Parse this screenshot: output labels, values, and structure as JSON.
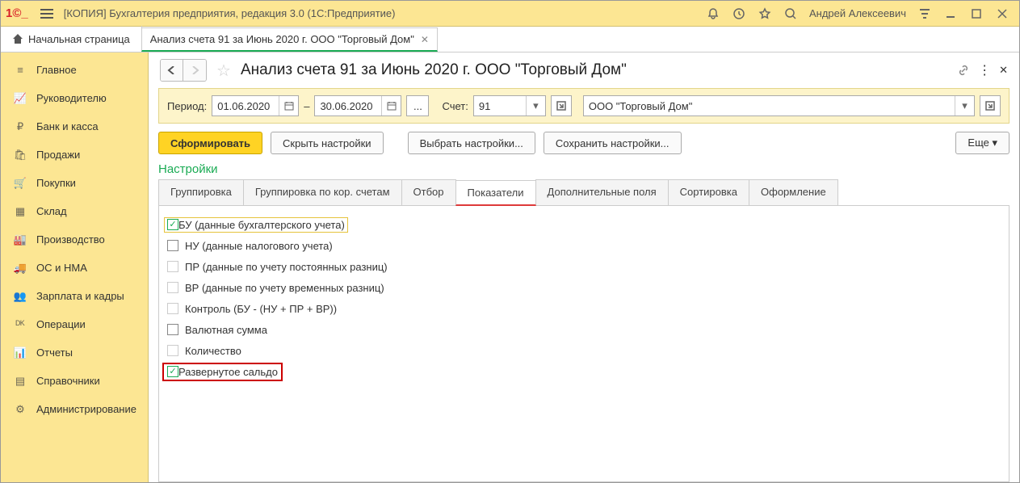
{
  "titlebar": {
    "title": "[КОПИЯ] Бухгалтерия предприятия, редакция 3.0  (1С:Предприятие)",
    "user": "Андрей Алексеевич"
  },
  "tabs": {
    "home": "Начальная страница",
    "doc": "Анализ счета 91 за Июнь 2020 г. ООО \"Торговый Дом\""
  },
  "sidebar": [
    "Главное",
    "Руководителю",
    "Банк и касса",
    "Продажи",
    "Покупки",
    "Склад",
    "Производство",
    "ОС и НМА",
    "Зарплата и кадры",
    "Операции",
    "Отчеты",
    "Справочники",
    "Администрирование"
  ],
  "page": {
    "title": "Анализ счета 91 за Июнь 2020 г. ООО \"Торговый Дом\""
  },
  "params": {
    "period_lbl": "Период:",
    "date_from": "01.06.2020",
    "dash": "–",
    "date_to": "30.06.2020",
    "account_lbl": "Счет:",
    "account": "91",
    "org": "ООО \"Торговый Дом\""
  },
  "buttons": {
    "form": "Сформировать",
    "hide": "Скрыть настройки",
    "choose": "Выбрать настройки...",
    "save": "Сохранить настройки...",
    "more": "Еще"
  },
  "settings_title": "Настройки",
  "tabs2": [
    "Группировка",
    "Группировка по кор. счетам",
    "Отбор",
    "Показатели",
    "Дополнительные поля",
    "Сортировка",
    "Оформление"
  ],
  "tabs2_active": 3,
  "checks": [
    {
      "label": "БУ (данные бухгалтерского учета)",
      "checked": true,
      "disabled": false,
      "first": true
    },
    {
      "label": "НУ (данные налогового учета)",
      "checked": false,
      "disabled": false
    },
    {
      "label": "ПР (данные по учету постоянных разниц)",
      "checked": false,
      "disabled": true
    },
    {
      "label": "ВР (данные по учету временных разниц)",
      "checked": false,
      "disabled": true
    },
    {
      "label": "Контроль (БУ - (НУ + ПР + ВР))",
      "checked": false,
      "disabled": true
    },
    {
      "label": "Валютная сумма",
      "checked": false,
      "disabled": false
    },
    {
      "label": "Количество",
      "checked": false,
      "disabled": true
    },
    {
      "label": "Развернутое сальдо",
      "checked": true,
      "disabled": false,
      "highlight": true
    }
  ]
}
